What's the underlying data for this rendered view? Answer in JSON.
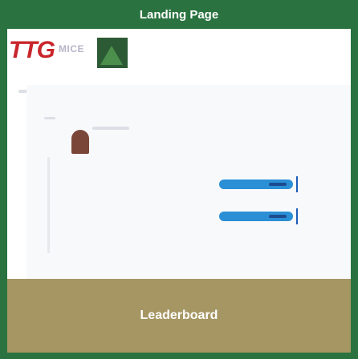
{
  "header": {
    "title": "Landing Page"
  },
  "logo": {
    "brand": "TTG",
    "sub": "MICE"
  },
  "footer": {
    "leaderboard_label": "Leaderboard"
  }
}
